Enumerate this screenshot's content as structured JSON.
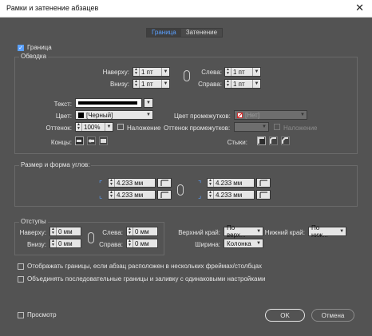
{
  "window": {
    "title": "Рамки и затенение абзацев",
    "close_glyph": "✕"
  },
  "tabs": [
    {
      "label": "Граница",
      "active": true
    },
    {
      "label": "Затенение",
      "active": false
    }
  ],
  "border_checkbox": {
    "label": "Граница",
    "checked": true
  },
  "stroke": {
    "title": "Обводка",
    "top": {
      "label": "Наверху:",
      "value": "1 пт"
    },
    "bottom": {
      "label": "Внизу:",
      "value": "1 пт"
    },
    "left": {
      "label": "Слева:",
      "value": "1 пт"
    },
    "right": {
      "label": "Справа:",
      "value": "1 пт"
    },
    "type_label": "Текст:",
    "color_label": "Цвет:",
    "color_value": "[Черный]",
    "gap_color_label": "Цвет промежутков:",
    "gap_color_value": "[Нет]",
    "tint_label": "Оттенок:",
    "tint_value": "100%",
    "overprint_label": "Наложение",
    "gap_tint_label": "Оттенок промежутков:",
    "gap_overprint_label": "Наложение",
    "caps_label": "Концы:",
    "joins_label": "Стыки:"
  },
  "corners": {
    "title": "Размер и форма углов:",
    "tl": "4.233 мм",
    "tr": "4.233 мм",
    "bl": "4.233 мм",
    "br": "4.233 мм"
  },
  "offsets": {
    "title": "Отступы",
    "top": {
      "label": "Наверху:",
      "value": "0 мм"
    },
    "bottom": {
      "label": "Внизу:",
      "value": "0 мм"
    },
    "left": {
      "label": "Слева:",
      "value": "0 мм"
    },
    "right": {
      "label": "Справа:",
      "value": "0 мм"
    },
    "top_edge": {
      "label": "Верхний край:",
      "value": "По верх..."
    },
    "bottom_edge": {
      "label": "Нижний край:",
      "value": "По ниж..."
    },
    "width": {
      "label": "Ширина:",
      "value": "Колонка"
    }
  },
  "options": [
    {
      "label": "Отображать границы, если абзац расположен в нескольких фреймах/столбцах",
      "checked": false
    },
    {
      "label": "Объединять последовательные границы и заливку с одинаковыми настройками",
      "checked": false
    }
  ],
  "preview": {
    "label": "Просмотр",
    "checked": false
  },
  "buttons": {
    "ok": "OK",
    "cancel": "Отмена"
  },
  "colors": {
    "accent": "#5aa0ff",
    "bg": "#535353"
  }
}
